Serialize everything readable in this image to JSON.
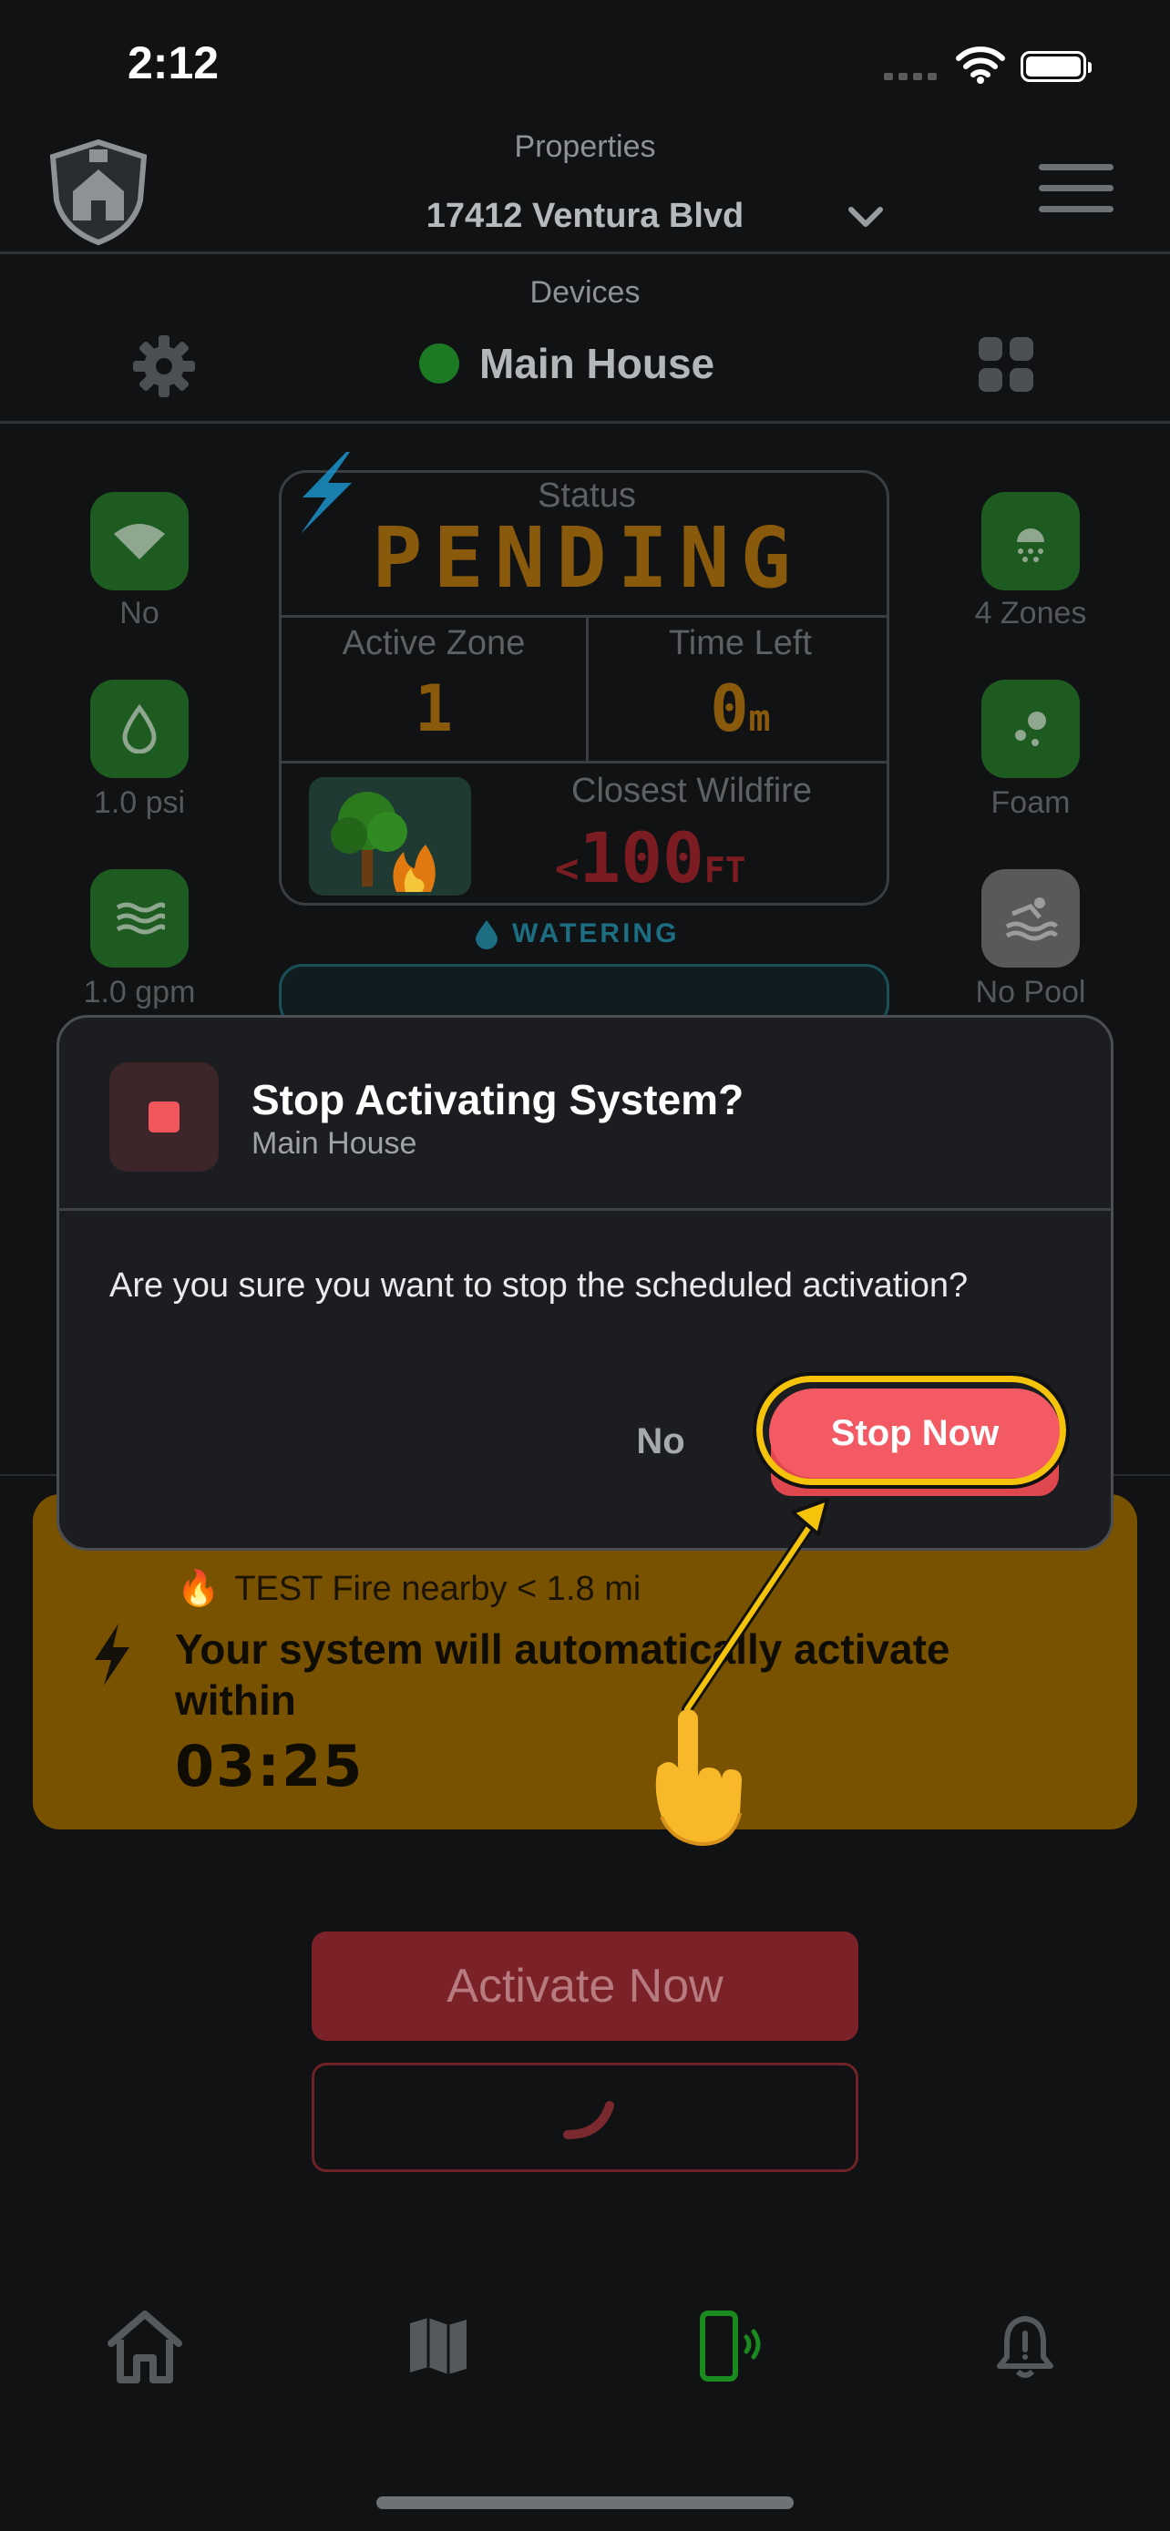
{
  "status_bar": {
    "time": "2:12"
  },
  "header": {
    "properties_label": "Properties",
    "property_name": "17412 Ventura Blvd",
    "devices_label": "Devices",
    "device_name": "Main House"
  },
  "left_tiles": [
    {
      "icon": "wifi-icon",
      "label": "No"
    },
    {
      "icon": "drop-icon",
      "label": "1.0 psi"
    },
    {
      "icon": "waves-icon",
      "label": "1.0 gpm"
    }
  ],
  "right_tiles": [
    {
      "icon": "sprinkler-icon",
      "label": "4 Zones"
    },
    {
      "icon": "foam-icon",
      "label": "Foam"
    },
    {
      "icon": "pool-icon",
      "label": "No Pool"
    }
  ],
  "status_panel": {
    "status_label": "Status",
    "status_value": "PENDING",
    "active_zone_label": "Active Zone",
    "active_zone_value": "1",
    "time_left_label": "Time Left",
    "time_left_value": "0",
    "time_left_unit": "m",
    "closest_wildfire_label": "Closest Wildfire",
    "closest_wildfire_prefix": "<",
    "closest_wildfire_value": "100",
    "closest_wildfire_unit": "FT"
  },
  "watering_label": "WATERING",
  "fire_warning": {
    "nearby_text": "TEST Fire nearby < 1.8 mi",
    "message": "Your system will automatically activate within",
    "countdown": "03:25"
  },
  "buttons": {
    "activate_label": "Activate Now"
  },
  "dialog": {
    "title": "Stop Activating System?",
    "subtitle": "Main House",
    "message": "Are you sure you want to stop the scheduled activation?",
    "no_label": "No",
    "stop_label": "Stop Now"
  },
  "colors": {
    "accent_red": "#f35a63",
    "highlight_yellow": "#f4c30a",
    "status_orange": "#8a5a0c",
    "warning_bg": "#795200",
    "active_tab_green": "#1a8a1f"
  }
}
